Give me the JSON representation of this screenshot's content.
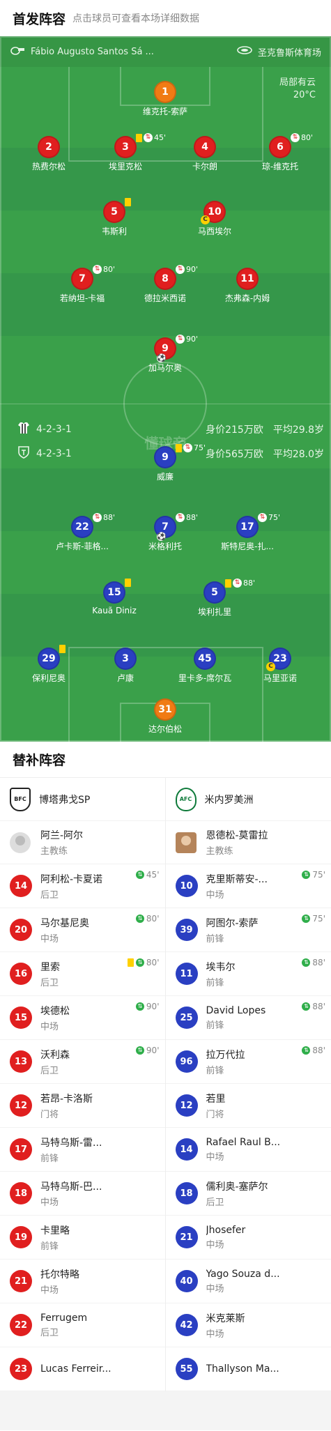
{
  "header": {
    "title": "首发阵容",
    "hint": "点击球员可查看本场详细数据"
  },
  "pitch": {
    "referee": "Fábio Augusto Santos Sá ...",
    "venue": "圣克鲁斯体育场",
    "weather": "局部有云",
    "temperature": "20°C",
    "watermark": "懂球帝",
    "home": {
      "formation": "4-2-3-1",
      "value": "身价215万欧",
      "age": "平均29.8岁"
    },
    "away": {
      "formation": "4-2-3-1",
      "value": "身价565万欧",
      "age": "平均28.0岁"
    }
  },
  "home_players": [
    {
      "id": "h1",
      "num": "1",
      "name": "维克托-索萨",
      "color": "orange"
    },
    {
      "id": "h2",
      "num": "2",
      "name": "热费尔松",
      "color": "red"
    },
    {
      "id": "h3",
      "num": "3",
      "name": "埃里克松",
      "color": "red",
      "yellow": true,
      "sub": "45'"
    },
    {
      "id": "h4",
      "num": "4",
      "name": "卡尔朗",
      "color": "red"
    },
    {
      "id": "h6",
      "num": "6",
      "name": "琼-维克托",
      "color": "red",
      "sub": "80'"
    },
    {
      "id": "h5",
      "num": "5",
      "name": "韦斯利",
      "color": "red",
      "yellow": true
    },
    {
      "id": "h10",
      "num": "10",
      "name": "马西埃尔",
      "color": "red",
      "captain": true
    },
    {
      "id": "h7",
      "num": "7",
      "name": "若纳坦-卡福",
      "color": "red",
      "sub": "80'"
    },
    {
      "id": "h8",
      "num": "8",
      "name": "德拉米西诺",
      "color": "red",
      "sub": "90'"
    },
    {
      "id": "h11",
      "num": "11",
      "name": "杰弗森-内姆",
      "color": "red"
    },
    {
      "id": "h9",
      "num": "9",
      "name": "加马尔奥",
      "color": "red",
      "sub": "90'",
      "goal": true
    }
  ],
  "away_players": [
    {
      "id": "a9",
      "num": "9",
      "name": "威廉",
      "color": "blue",
      "yellow": true,
      "sub": "75'"
    },
    {
      "id": "a22",
      "num": "22",
      "name": "卢卡斯-菲格...",
      "color": "blue",
      "sub": "88'"
    },
    {
      "id": "a7",
      "num": "7",
      "name": "米格利托",
      "color": "blue",
      "sub": "88'",
      "goal": true
    },
    {
      "id": "a17",
      "num": "17",
      "name": "斯特尼奥-扎...",
      "color": "blue",
      "sub": "75'"
    },
    {
      "id": "a15",
      "num": "15",
      "name": "Kauã Diniz",
      "color": "blue",
      "yellow": true
    },
    {
      "id": "a5",
      "num": "5",
      "name": "埃利扎里",
      "color": "blue",
      "yellow": true,
      "sub": "88'"
    },
    {
      "id": "a29",
      "num": "29",
      "name": "保利尼奥",
      "color": "blue",
      "yellow": true
    },
    {
      "id": "a3",
      "num": "3",
      "name": "卢康",
      "color": "blue"
    },
    {
      "id": "a45",
      "num": "45",
      "name": "里卡多-席尔瓦",
      "color": "blue"
    },
    {
      "id": "a23",
      "num": "23",
      "name": "马里亚诺",
      "color": "blue",
      "captain": true
    },
    {
      "id": "a31",
      "num": "31",
      "name": "达尔伯松",
      "color": "orange"
    }
  ],
  "subs": {
    "title": "替补阵容",
    "home": {
      "team": "博塔弗戈SP",
      "crest": "BFC",
      "coach": {
        "name": "阿兰-阿尔",
        "role": "主教练"
      },
      "players": [
        {
          "num": "14",
          "name": "阿利松-卡夏诺",
          "pos": "后卫",
          "in": "45'"
        },
        {
          "num": "20",
          "name": "马尔基尼奥",
          "pos": "中场",
          "in": "80'"
        },
        {
          "num": "16",
          "name": "里索",
          "pos": "后卫",
          "in": "80'",
          "yellow": true
        },
        {
          "num": "15",
          "name": "埃德松",
          "pos": "中场",
          "in": "90'"
        },
        {
          "num": "13",
          "name": "沃利森",
          "pos": "后卫",
          "in": "90'"
        },
        {
          "num": "12",
          "name": "若昂-卡洛斯",
          "pos": "门将"
        },
        {
          "num": "17",
          "name": "马特乌斯-雷...",
          "pos": "前锋"
        },
        {
          "num": "18",
          "name": "马特乌斯-巴...",
          "pos": "中场"
        },
        {
          "num": "19",
          "name": "卡里略",
          "pos": "前锋"
        },
        {
          "num": "21",
          "name": "托尔特略",
          "pos": "中场"
        },
        {
          "num": "22",
          "name": "Ferrugem",
          "pos": "后卫"
        },
        {
          "num": "23",
          "name": "Lucas Ferreir...",
          "pos": ""
        }
      ]
    },
    "away": {
      "team": "米内罗美洲",
      "crest": "AFC",
      "coach": {
        "name": "恩德松-莫雷拉",
        "role": "主教练"
      },
      "players": [
        {
          "num": "10",
          "name": "克里斯蒂安-...",
          "pos": "中场",
          "in": "75'"
        },
        {
          "num": "39",
          "name": "阿图尔-索萨",
          "pos": "前锋",
          "in": "75'"
        },
        {
          "num": "11",
          "name": "埃韦尔",
          "pos": "前锋",
          "in": "88'"
        },
        {
          "num": "25",
          "name": "David Lopes",
          "pos": "前锋",
          "in": "88'"
        },
        {
          "num": "96",
          "name": "拉万代拉",
          "pos": "前锋",
          "in": "88'"
        },
        {
          "num": "12",
          "name": "若里",
          "pos": "门将"
        },
        {
          "num": "14",
          "name": "Rafael Raul B...",
          "pos": "中场"
        },
        {
          "num": "18",
          "name": "儒利奥-塞萨尔",
          "pos": "后卫"
        },
        {
          "num": "21",
          "name": "Jhosefer",
          "pos": "中场"
        },
        {
          "num": "40",
          "name": "Yago Souza d...",
          "pos": "中场"
        },
        {
          "num": "42",
          "name": "米克莱斯",
          "pos": "中场"
        },
        {
          "num": "55",
          "name": "Thallyson Ma...",
          "pos": ""
        }
      ]
    }
  }
}
